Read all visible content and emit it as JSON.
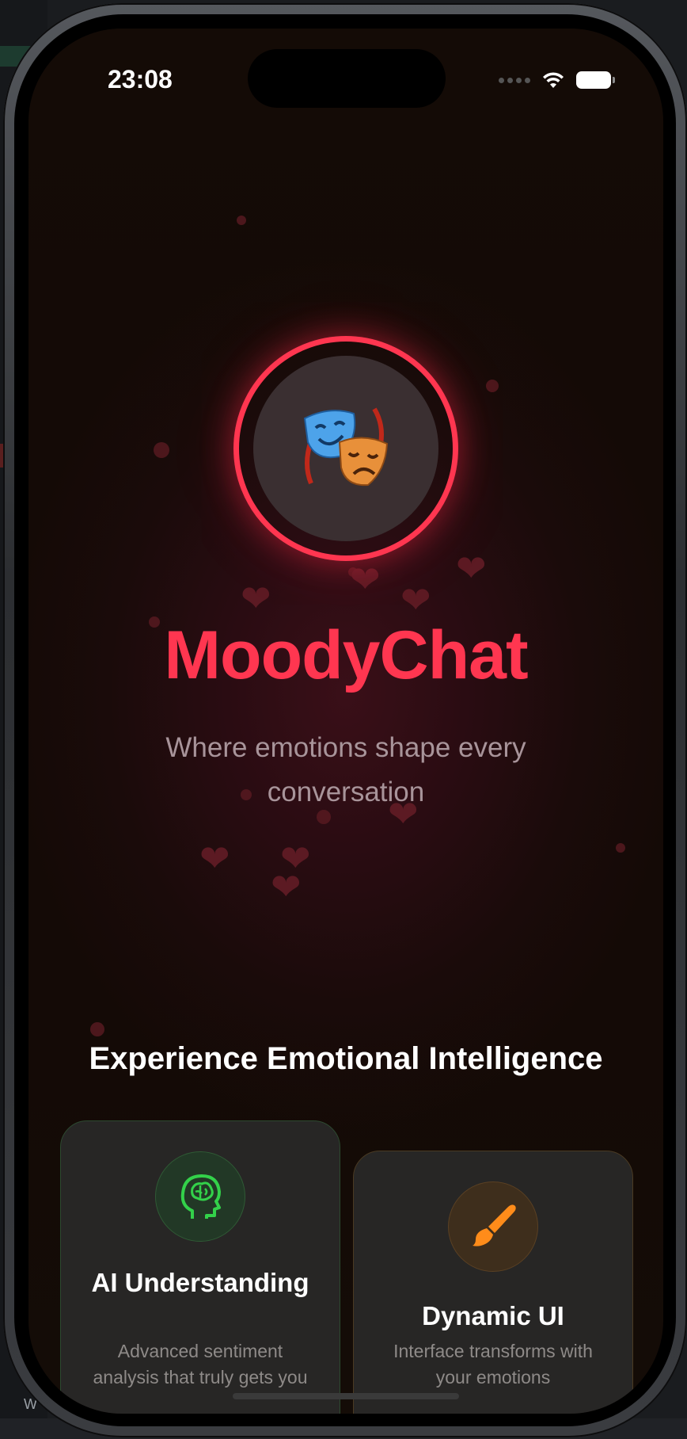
{
  "status_bar": {
    "time": "23:08",
    "icons": [
      "cellular-dots-icon",
      "wifi-icon",
      "battery-icon"
    ]
  },
  "logo": {
    "icon": "theater-masks-icon",
    "ring_color": "#ff3650"
  },
  "hero": {
    "title": "MoodyChat",
    "subtitle": "Where emotions shape every conversation"
  },
  "features": {
    "heading": "Experience Emotional Intelligence",
    "cards": [
      {
        "icon": "brain-head-icon",
        "title": "AI Understanding",
        "description": "Advanced sentiment analysis that truly gets you",
        "accent": "#2ecc40"
      },
      {
        "icon": "paintbrush-icon",
        "title": "Dynamic UI",
        "description": "Interface transforms with your emotions",
        "accent": "#ff8c1a"
      }
    ]
  },
  "background": {
    "left_window_text": "W"
  },
  "colors": {
    "brand": "#ff3650",
    "background": "#1a0b0a",
    "subtitle": "#a8949a"
  }
}
